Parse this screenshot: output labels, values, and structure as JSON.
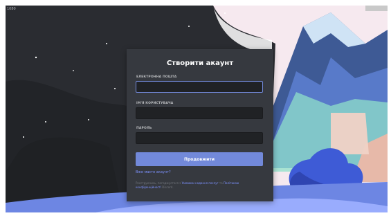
{
  "window": {
    "top_label": "1080",
    "top_right_tab": ""
  },
  "card": {
    "title": "Створити акаунт",
    "email": {
      "label": "ЕЛЕКТРОННА ПОШТА",
      "value": "",
      "placeholder": ""
    },
    "username": {
      "label": "ІМ'Я КОРИСТУВАЧА",
      "value": "",
      "placeholder": ""
    },
    "password": {
      "label": "ПАРОЛЬ",
      "value": "",
      "placeholder": ""
    },
    "continue_button": "Продовжити",
    "login_link": "Вже маєте акаунт?",
    "terms_prefix": "Реєструючись, погоджуєтеся з",
    "terms_link": "Умовами надання послуг",
    "terms_mid": "та",
    "privacy_link": "Політикою конфіденційності",
    "terms_suffix": "Discord."
  },
  "colors": {
    "accent": "#7289da",
    "card_bg": "#36393f",
    "input_bg": "#202225",
    "night_sky": "#2a2c31"
  }
}
